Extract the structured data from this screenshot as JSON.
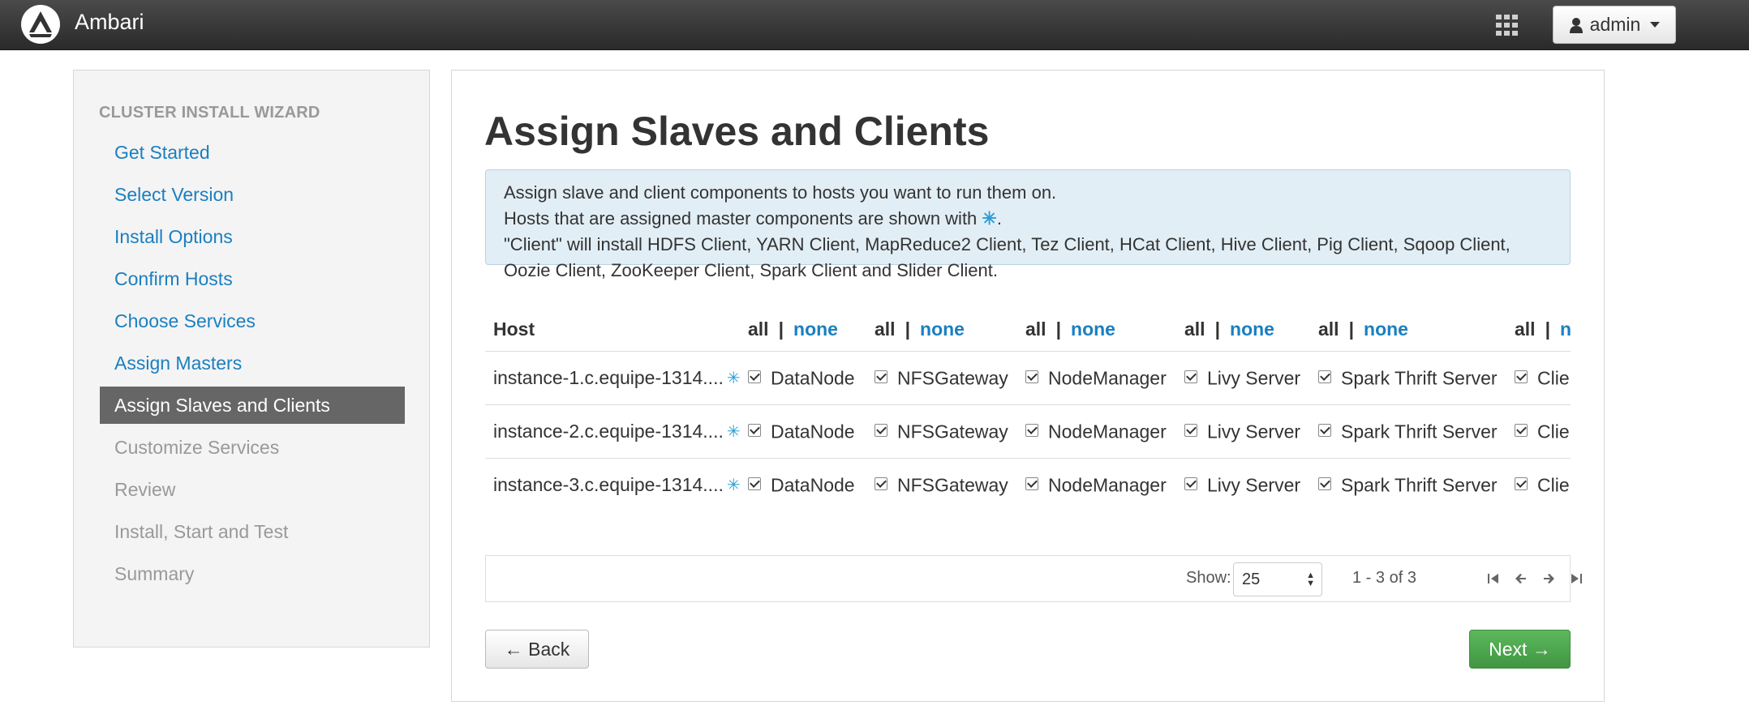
{
  "app": {
    "title": "Ambari",
    "user_label": "admin",
    "icons": {
      "logo": "ambari-logo-icon",
      "apps": "grid-icon",
      "user": "user-icon"
    }
  },
  "sidebar": {
    "title": "CLUSTER INSTALL WIZARD",
    "items": [
      {
        "label": "Get Started",
        "state": "link"
      },
      {
        "label": "Select Version",
        "state": "link"
      },
      {
        "label": "Install Options",
        "state": "link"
      },
      {
        "label": "Confirm Hosts",
        "state": "link"
      },
      {
        "label": "Choose Services",
        "state": "link"
      },
      {
        "label": "Assign Masters",
        "state": "link"
      },
      {
        "label": "Assign Slaves and Clients",
        "state": "active"
      },
      {
        "label": "Customize Services",
        "state": "disabled"
      },
      {
        "label": "Review",
        "state": "disabled"
      },
      {
        "label": "Install, Start and Test",
        "state": "disabled"
      },
      {
        "label": "Summary",
        "state": "disabled"
      }
    ]
  },
  "main": {
    "title": "Assign Slaves and Clients",
    "info": {
      "line1": "Assign slave and client components to hosts you want to run them on.",
      "line2_prefix": "Hosts that are assigned master components are shown with",
      "line2_star": "✳",
      "line2_suffix": ".",
      "line3": "\"Client\" will install HDFS Client, YARN Client, MapReduce2 Client, Tez Client, HCat Client, Hive Client, Pig Client, Sqoop Client, Oozie Client, ZooKeeper Client, Spark Client and Slider Client."
    },
    "table": {
      "host_header": "Host",
      "all_label": "all",
      "separator": "|",
      "none_label": "none",
      "components": [
        "DataNode",
        "NFSGateway",
        "NodeManager",
        "Livy Server",
        "Spark Thrift Server",
        "Client"
      ],
      "rows": [
        {
          "host": "instance-1.c.equipe-1314....",
          "master_star": "✳",
          "checked": [
            true,
            true,
            true,
            true,
            true,
            true
          ]
        },
        {
          "host": "instance-2.c.equipe-1314....",
          "master_star": "✳",
          "checked": [
            true,
            true,
            true,
            true,
            true,
            true
          ]
        },
        {
          "host": "instance-3.c.equipe-1314....",
          "master_star": "✳",
          "checked": [
            true,
            true,
            true,
            true,
            true,
            true
          ]
        }
      ]
    },
    "pager": {
      "show_label": "Show:",
      "page_size": "25",
      "range": "1 - 3 of 3"
    },
    "buttons": {
      "back": "← Back",
      "next": "Next →"
    }
  },
  "colors": {
    "link": "#1a7fc1",
    "active_nav_bg": "#666666",
    "info_bg": "#e2eef5",
    "next_bg": "#5cb85c",
    "topbar_bg": "#333333"
  }
}
